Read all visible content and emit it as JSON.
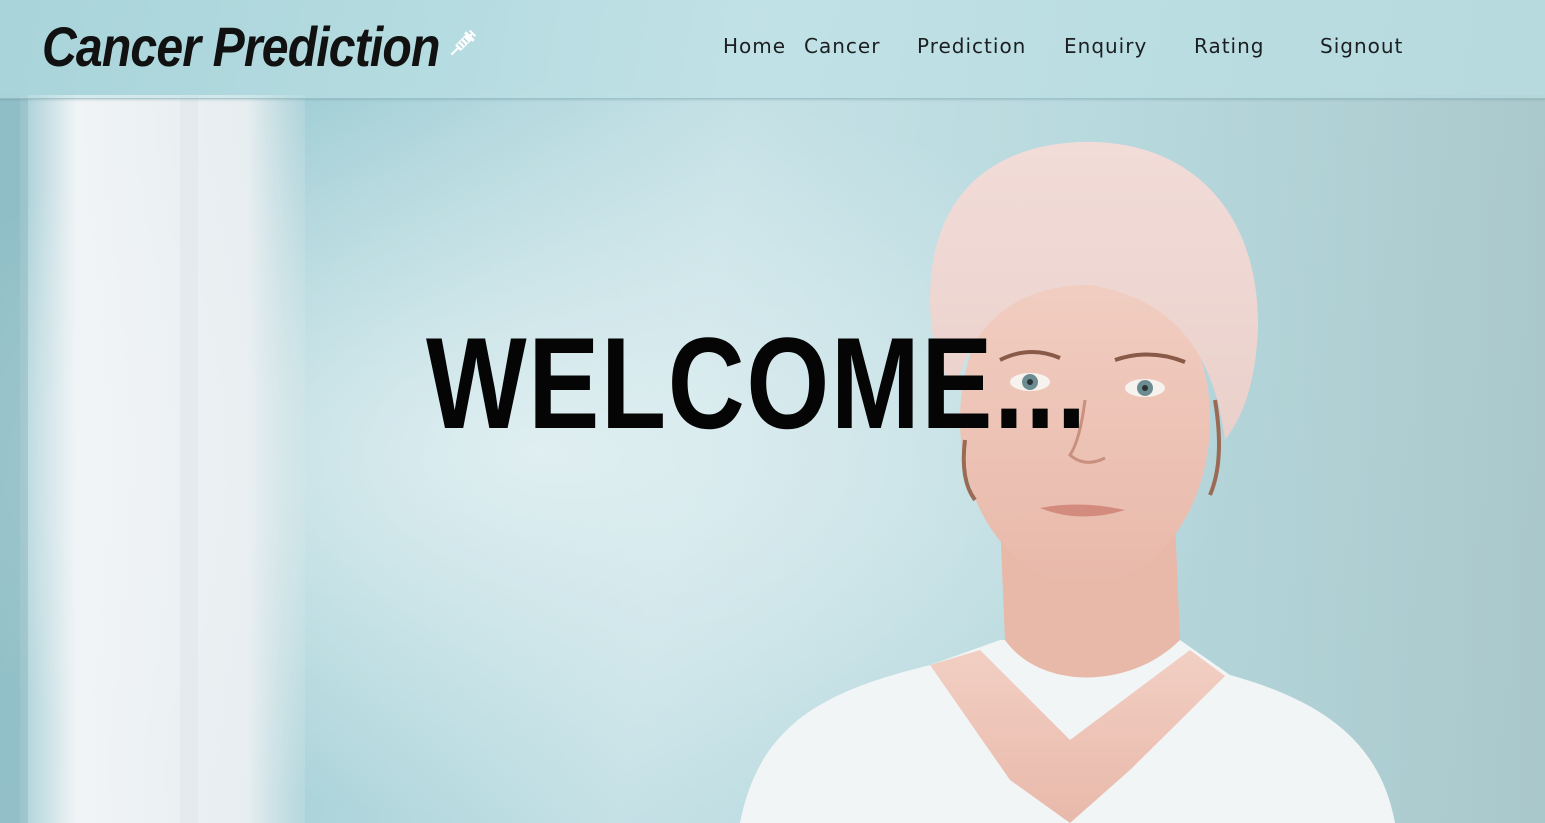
{
  "header": {
    "brand_title": "Cancer Prediction",
    "brand_icon": "syringe-icon",
    "nav": [
      {
        "label": "Home"
      },
      {
        "label": "Cancer"
      },
      {
        "label": "Prediction"
      },
      {
        "label": "Enquiry"
      },
      {
        "label": "Rating"
      },
      {
        "label": "Signout"
      }
    ]
  },
  "hero": {
    "heading": "WELCOME...",
    "image": "woman-in-headscarf-photo"
  },
  "colors": {
    "background": "#b4d6dc",
    "text": "#050505"
  }
}
